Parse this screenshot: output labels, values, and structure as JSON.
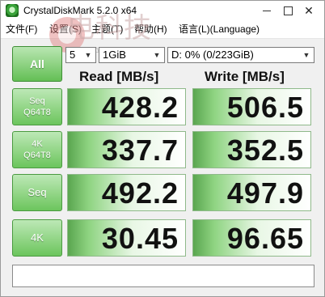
{
  "window": {
    "title": "CrystalDiskMark 5.2.0 x64",
    "close_glyph": "✕"
  },
  "menu": {
    "items": [
      "文件(F)",
      "设置(S)",
      "主题(T)",
      "帮助(H)",
      "语言(L)(Language)"
    ]
  },
  "watermark": {
    "chinese": "电科技",
    "latin": "DIANKEJI"
  },
  "controls": {
    "all_label": "All",
    "count_value": "5",
    "size_value": "1GiB",
    "drive_value": "D: 0% (0/223GiB)",
    "dropdown_arrow": "▼"
  },
  "columns": {
    "read_header": "Read [MB/s]",
    "write_header": "Write [MB/s]"
  },
  "tests": [
    {
      "line1": "Seq",
      "line2": "Q64T8",
      "read": "428.2",
      "write": "506.5"
    },
    {
      "line1": "4K",
      "line2": "Q64T8",
      "read": "337.7",
      "write": "352.5"
    },
    {
      "line1": "Seq",
      "line2": "",
      "read": "492.2",
      "write": "497.9"
    },
    {
      "line1": "4K",
      "line2": "",
      "read": "30.45",
      "write": "96.65"
    }
  ],
  "comment": {
    "value": ""
  },
  "colors": {
    "button_green": "#6cc55d",
    "result_green": "#5aa64f"
  }
}
